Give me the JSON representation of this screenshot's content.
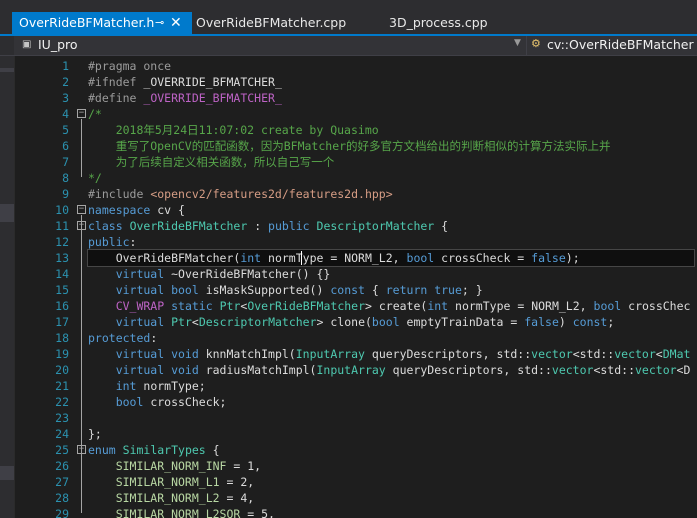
{
  "tabs": [
    {
      "label": "OverRideBFMatcher.h",
      "active": true
    },
    {
      "label": "OverRideBFMatcher.cpp",
      "active": false
    },
    {
      "label": "3D_process.cpp",
      "active": false
    }
  ],
  "icons": {
    "pin": "pin-icon",
    "close": "close-icon",
    "dropdown": "chevron-down-icon",
    "scope": "class-scope-icon"
  },
  "navbar": {
    "project": "IU_pro",
    "scope": "cv::OverRideBFMatcher"
  },
  "editor": {
    "lines": [
      {
        "n": 1,
        "segs": [
          [
            "p",
            "#pragma once"
          ]
        ]
      },
      {
        "n": 2,
        "segs": [
          [
            "p",
            "#ifndef "
          ],
          [
            "",
            "_OVERRIDE_BFMATCHER_"
          ]
        ]
      },
      {
        "n": 3,
        "segs": [
          [
            "p",
            "#define "
          ],
          [
            "m",
            "_OVERRIDE_BFMATCHER_"
          ]
        ]
      },
      {
        "n": 4,
        "segs": [
          [
            "c",
            "/*"
          ]
        ]
      },
      {
        "n": 5,
        "segs": [
          [
            "c",
            "    2018年5月24日11:07:02 create by Quasimo"
          ]
        ]
      },
      {
        "n": 6,
        "segs": [
          [
            "c",
            "    重写了OpenCV的匹配函数，因为BFMatcher的好多官方文档给出的判断相似的计算方法实际上并"
          ]
        ]
      },
      {
        "n": 7,
        "segs": [
          [
            "c",
            "    为了后续自定义相关函数，所以自己写一个"
          ]
        ]
      },
      {
        "n": 8,
        "segs": [
          [
            "c",
            "*/"
          ]
        ]
      },
      {
        "n": 9,
        "segs": [
          [
            "p",
            "#include "
          ],
          [
            "s",
            "<opencv2/features2d/features2d.hpp>"
          ]
        ]
      },
      {
        "n": 10,
        "segs": [
          [
            "k",
            "namespace"
          ],
          [
            "",
            " cv {"
          ]
        ]
      },
      {
        "n": 11,
        "segs": [
          [
            "k",
            "class"
          ],
          [
            "",
            " "
          ],
          [
            "t",
            "OverRideBFMatcher"
          ],
          [
            "",
            " : "
          ],
          [
            "k",
            "public"
          ],
          [
            "",
            " "
          ],
          [
            "t",
            "DescriptorMatcher"
          ],
          [
            "",
            " {"
          ]
        ]
      },
      {
        "n": 12,
        "segs": [
          [
            "k",
            "public"
          ],
          [
            "",
            ":"
          ]
        ]
      },
      {
        "n": 13,
        "segs": [
          [
            "",
            "    OverRideBFMatcher("
          ],
          [
            "k",
            "int"
          ],
          [
            "",
            " normType = NORM_L2, "
          ],
          [
            "k",
            "bool"
          ],
          [
            "",
            " crossCheck = "
          ],
          [
            "k",
            "false"
          ],
          [
            "",
            ");"
          ]
        ]
      },
      {
        "n": 14,
        "segs": [
          [
            "k",
            "    virtual"
          ],
          [
            "",
            " ~OverRideBFMatcher() {}"
          ]
        ]
      },
      {
        "n": 15,
        "segs": [
          [
            "k",
            "    virtual bool"
          ],
          [
            "",
            " isMaskSupported() "
          ],
          [
            "k",
            "const"
          ],
          [
            "",
            " { "
          ],
          [
            "k",
            "return true"
          ],
          [
            "",
            "; }"
          ]
        ]
      },
      {
        "n": 16,
        "segs": [
          [
            "m",
            "    CV_WRAP"
          ],
          [
            "",
            " "
          ],
          [
            "k",
            "static"
          ],
          [
            "",
            " "
          ],
          [
            "t",
            "Ptr"
          ],
          [
            "",
            "<"
          ],
          [
            "t",
            "OverRideBFMatcher"
          ],
          [
            "",
            "> create("
          ],
          [
            "k",
            "int"
          ],
          [
            "",
            " normType = NORM_L2, "
          ],
          [
            "k",
            "bool"
          ],
          [
            "",
            " crossChec"
          ]
        ]
      },
      {
        "n": 17,
        "segs": [
          [
            "k",
            "    virtual"
          ],
          [
            "",
            " "
          ],
          [
            "t",
            "Ptr"
          ],
          [
            "",
            "<"
          ],
          [
            "t",
            "DescriptorMatcher"
          ],
          [
            "",
            "> clone("
          ],
          [
            "k",
            "bool"
          ],
          [
            "",
            " emptyTrainData = "
          ],
          [
            "k",
            "false"
          ],
          [
            "",
            ") "
          ],
          [
            "k",
            "const"
          ],
          [
            "",
            ";"
          ]
        ]
      },
      {
        "n": 18,
        "segs": [
          [
            "k",
            "protected"
          ],
          [
            "",
            ":"
          ]
        ]
      },
      {
        "n": 19,
        "segs": [
          [
            "k",
            "    virtual void"
          ],
          [
            "",
            " knnMatchImpl("
          ],
          [
            "t",
            "InputArray"
          ],
          [
            "",
            " queryDescriptors, std::"
          ],
          [
            "t",
            "vector"
          ],
          [
            "",
            "<std::"
          ],
          [
            "t",
            "vector"
          ],
          [
            "",
            "<"
          ],
          [
            "t",
            "DMat"
          ]
        ]
      },
      {
        "n": 20,
        "segs": [
          [
            "k",
            "    virtual void"
          ],
          [
            "",
            " radiusMatchImpl("
          ],
          [
            "t",
            "InputArray"
          ],
          [
            "",
            " queryDescriptors, std::"
          ],
          [
            "t",
            "vector"
          ],
          [
            "",
            "<std::"
          ],
          [
            "t",
            "vector"
          ],
          [
            "",
            "<D"
          ]
        ]
      },
      {
        "n": 21,
        "segs": [
          [
            "k",
            "    int"
          ],
          [
            "",
            " normType;"
          ]
        ]
      },
      {
        "n": 22,
        "segs": [
          [
            "k",
            "    bool"
          ],
          [
            "",
            " crossCheck;"
          ]
        ]
      },
      {
        "n": 23,
        "segs": [
          [
            "",
            ""
          ]
        ]
      },
      {
        "n": 24,
        "segs": [
          [
            "",
            "};"
          ]
        ]
      },
      {
        "n": 25,
        "segs": [
          [
            "k",
            "enum"
          ],
          [
            "",
            " "
          ],
          [
            "t",
            "SimilarTypes"
          ],
          [
            "",
            " {"
          ]
        ]
      },
      {
        "n": 26,
        "segs": [
          [
            "e",
            "    SIMILAR_NORM_INF"
          ],
          [
            "",
            " = 1,"
          ]
        ]
      },
      {
        "n": 27,
        "segs": [
          [
            "e",
            "    SIMILAR_NORM_L1"
          ],
          [
            "",
            " = 2,"
          ]
        ]
      },
      {
        "n": 28,
        "segs": [
          [
            "e",
            "    SIMILAR_NORM_L2"
          ],
          [
            "",
            " = 4,"
          ]
        ]
      },
      {
        "n": 29,
        "segs": [
          [
            "e",
            "    SIMILAR_NORM_L2SQR"
          ],
          [
            "",
            " = 5,"
          ]
        ]
      }
    ]
  }
}
